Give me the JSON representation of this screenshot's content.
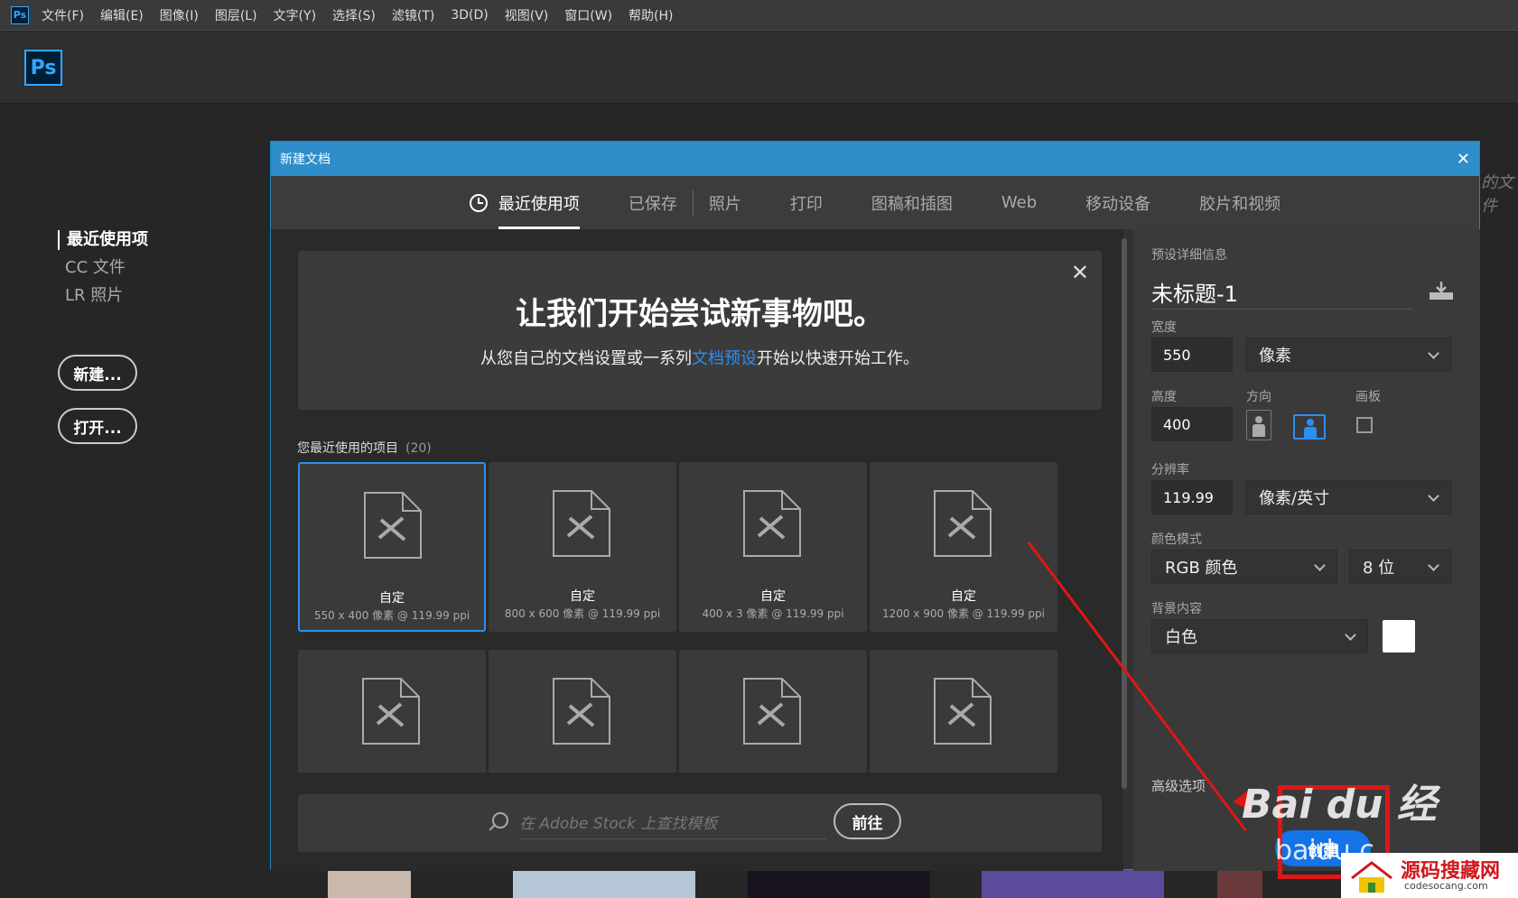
{
  "menubar": {
    "items": [
      "文件(F)",
      "编辑(E)",
      "图像(I)",
      "图层(L)",
      "文字(Y)",
      "选择(S)",
      "滤镜(T)",
      "3D(D)",
      "视图(V)",
      "窗口(W)",
      "帮助(H)"
    ],
    "ps_mini": "Ps"
  },
  "topbar": {
    "logo": "Ps"
  },
  "left_nav": {
    "items": [
      "最近使用项",
      "CC 文件",
      "LR 照片"
    ],
    "new_button": "新建...",
    "open_button": "打开..."
  },
  "dialog": {
    "title": "新建文档",
    "close": "✕",
    "tabs": [
      "最近使用项",
      "已保存",
      "照片",
      "打印",
      "图稿和插图",
      "Web",
      "移动设备",
      "胶片和视频"
    ],
    "welcome": {
      "heading": "让我们开始尝试新事物吧。",
      "text_before": "从您自己的文档设置或一系列",
      "link": "文档预设",
      "text_after": "开始以快速开始工作。",
      "close": "✕"
    },
    "recent": {
      "label": "您最近使用的项目",
      "count": "(20)",
      "items": [
        {
          "name": "自定",
          "sub": "550 x 400 像素 @ 119.99 ppi"
        },
        {
          "name": "自定",
          "sub": "800 x 600 像素 @ 119.99 ppi"
        },
        {
          "name": "自定",
          "sub": "400 x 3 像素 @ 119.99 ppi"
        },
        {
          "name": "自定",
          "sub": "1200 x 900 像素 @ 119.99 ppi"
        }
      ]
    },
    "stock": {
      "placeholder": "在 Adobe Stock 上查找模板",
      "go_button": "前往"
    },
    "preset": {
      "section_label": "预设详细信息",
      "doc_title": "未标题-1",
      "width_label": "宽度",
      "width_value": "550",
      "width_unit": "像素",
      "height_label": "高度",
      "height_value": "400",
      "orientation_label": "方向",
      "artboard_label": "画板",
      "resolution_label": "分辨率",
      "resolution_value": "119.99",
      "resolution_unit": "像素/英寸",
      "color_mode_label": "颜色模式",
      "color_mode": "RGB 颜色",
      "bit_depth": "8 位",
      "bg_label": "背景内容",
      "bg_value": "白色",
      "advanced": "高级选项",
      "create_button": "创建"
    }
  },
  "overlay": {
    "baidu": "Bai du 经",
    "baidu_sub": "baidu.c",
    "watermark_main": "源码搜藏网",
    "watermark_sub": "codesocang.com",
    "side_text": "的文件"
  },
  "colors": {
    "accent": "#2d8ef2",
    "titlebar": "#2d8ec9",
    "annotation": "#e01616",
    "create": "#1473e6"
  }
}
